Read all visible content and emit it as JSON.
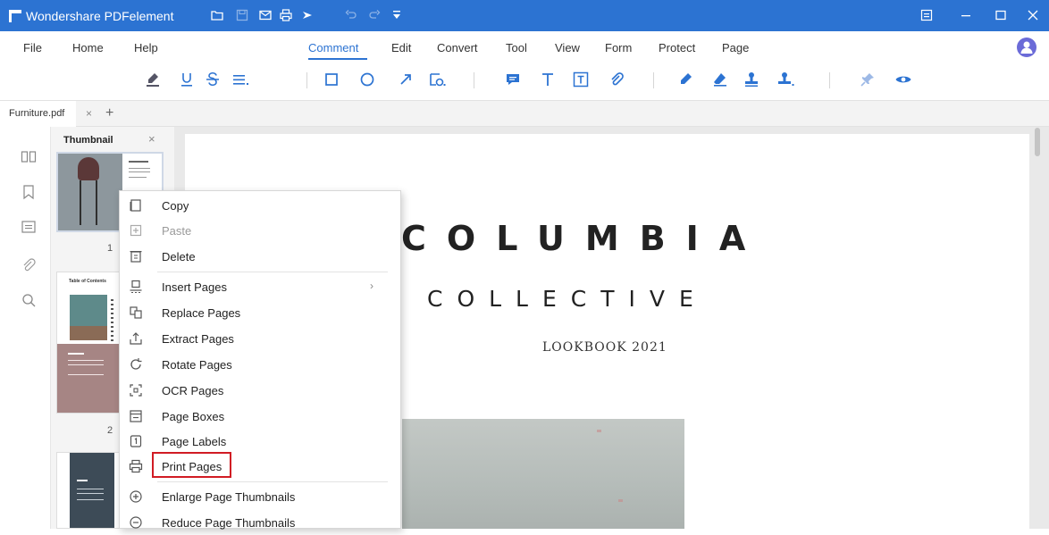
{
  "titlebar": {
    "title": "Wondershare PDFelement"
  },
  "menubar": {
    "items": [
      "File",
      "Home",
      "Help",
      "Comment",
      "Edit",
      "Convert",
      "Tool",
      "View",
      "Form",
      "Protect",
      "Page"
    ],
    "active": "Comment"
  },
  "toolbar": {
    "icons": [
      "highlight-icon",
      "underline-icon",
      "strikethrough-icon",
      "text-lines-icon",
      "rectangle-icon",
      "circle-icon",
      "arrow-icon",
      "shape-more-icon",
      "note-icon",
      "text-icon",
      "textbox-icon",
      "attachment-icon",
      "pencil-icon",
      "eraser-icon",
      "stamp-icon",
      "stamp-more-icon",
      "pin-icon",
      "eye-icon"
    ]
  },
  "tabs": [
    {
      "label": "Furniture.pdf",
      "close": "×"
    }
  ],
  "tab_add": "+",
  "thumbnail_panel": {
    "title": "Thumbnail",
    "close": "×",
    "page_numbers": [
      "1",
      "2"
    ]
  },
  "thumb2_heading": "Table of Contents",
  "document": {
    "title": "COLUMBIA",
    "subtitle": "COLLECTIVE",
    "year_line": "LOOKBOOK 2021"
  },
  "context_menu": {
    "items": [
      {
        "label": "Copy",
        "icon": "copy-icon",
        "disabled": false
      },
      {
        "label": "Paste",
        "icon": "paste-icon",
        "disabled": true
      },
      {
        "label": "Delete",
        "icon": "delete-icon",
        "disabled": false
      },
      {
        "label": "Insert Pages",
        "icon": "insert-pages-icon",
        "disabled": false,
        "submenu": true
      },
      {
        "label": "Replace Pages",
        "icon": "replace-pages-icon",
        "disabled": false
      },
      {
        "label": "Extract Pages",
        "icon": "extract-pages-icon",
        "disabled": false
      },
      {
        "label": "Rotate Pages",
        "icon": "rotate-pages-icon",
        "disabled": false
      },
      {
        "label": "OCR Pages",
        "icon": "ocr-pages-icon",
        "disabled": false
      },
      {
        "label": "Page Boxes",
        "icon": "page-boxes-icon",
        "disabled": false
      },
      {
        "label": "Page Labels",
        "icon": "page-labels-icon",
        "disabled": false
      },
      {
        "label": "Print Pages",
        "icon": "print-pages-icon",
        "disabled": false,
        "highlighted": true
      },
      {
        "label": "Enlarge Page Thumbnails",
        "icon": "zoom-in-icon",
        "disabled": false
      },
      {
        "label": "Reduce Page Thumbnails",
        "icon": "zoom-out-icon",
        "disabled": false
      }
    ],
    "submenu_arrow": "›"
  },
  "colors": {
    "titlebar": "#2c73d2",
    "accent": "#2c73d2",
    "highlight_box": "#d11b24"
  }
}
